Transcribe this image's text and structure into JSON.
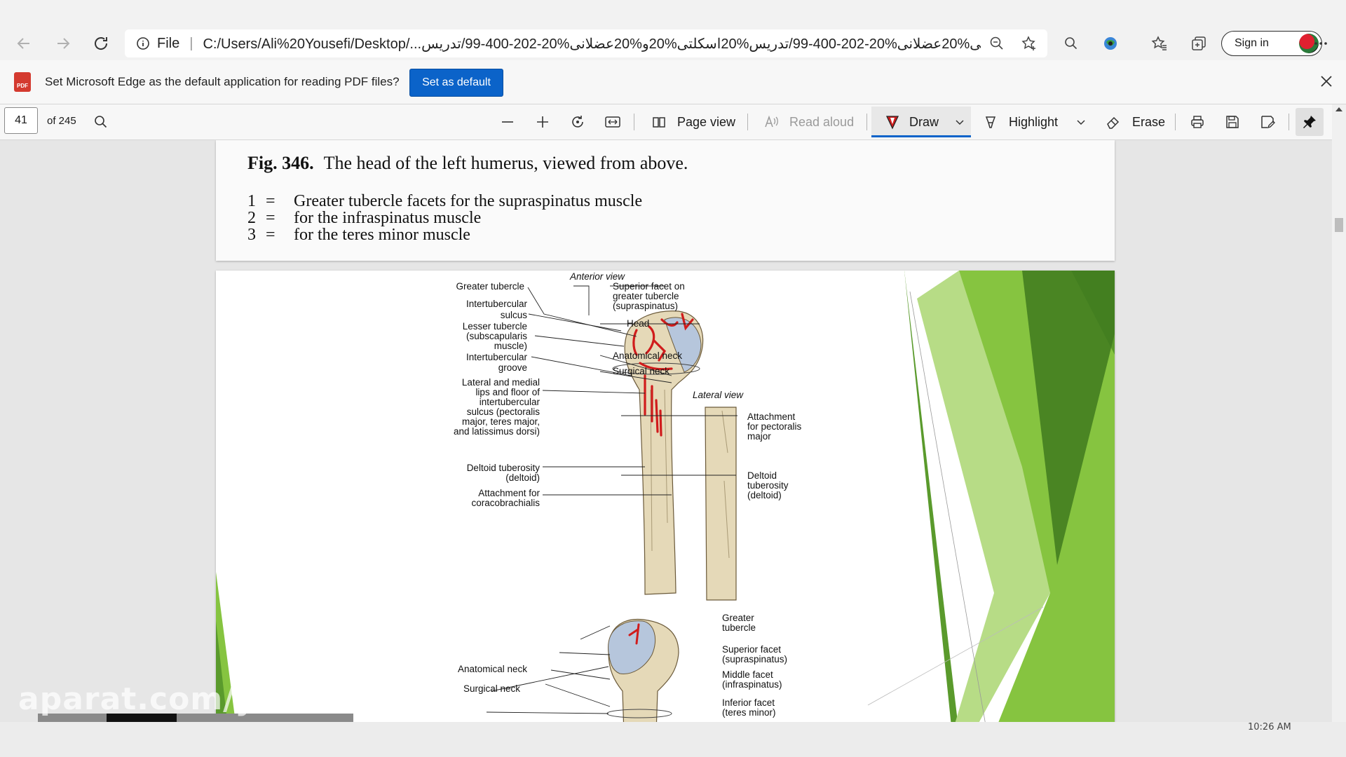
{
  "browser": {
    "address": {
      "scheme_label": "File",
      "url": "C:/Users/Ali%20Yousefi/Desktop/...تدریس%20اسکلتی%20عضلانی%20-202-400-99/تدریس%20اسکلتی%20و%20عضلانی%20-202-400-99/تدریس"
    },
    "sign_in_label": "Sign in",
    "icons": {
      "back": "back-arrow-icon",
      "forward": "forward-arrow-icon",
      "refresh": "refresh-icon",
      "info": "info-icon",
      "zoom": "zoom-out-icon",
      "favorite": "add-favorite-icon",
      "search": "search-icon",
      "extension": "extension-icon",
      "favorites": "favorites-icon",
      "collections": "collections-icon",
      "more": "more-icon"
    }
  },
  "infobar": {
    "message": "Set Microsoft Edge as the default application for reading PDF files?",
    "button_label": "Set as default",
    "badge_text": "PDF"
  },
  "pdf_toolbar": {
    "page_current": "41",
    "page_total": "of 245",
    "page_view_label": "Page view",
    "read_aloud_label": "Read aloud",
    "draw_label": "Draw",
    "highlight_label": "Highlight",
    "erase_label": "Erase",
    "accent_color": "#0b63c9",
    "draw_color": "#d01c1c"
  },
  "document": {
    "page1": {
      "fig_number": "Fig. 346.",
      "fig_title": "The head of the left humerus, viewed from above.",
      "legend": [
        {
          "num": "1",
          "eq": "=",
          "text": "Greater tubercle facets for the supraspinatus muscle"
        },
        {
          "num": "2",
          "eq": "=",
          "text": "for the infraspinatus muscle"
        },
        {
          "num": "3",
          "eq": "=",
          "text": "for the teres minor muscle"
        }
      ]
    },
    "page2": {
      "anterior_view": "Anterior view",
      "lateral_view": "Lateral view",
      "labels_left": {
        "greater_tubercle": "Greater tubercle",
        "intertubercular_sulcus": [
          "Intertubercular",
          "sulcus"
        ],
        "lesser_tubercle": [
          "Lesser tubercle",
          "(subscapularis",
          "muscle)"
        ],
        "intertubercular_groove": [
          "Intertubercular",
          "groove"
        ],
        "lips": [
          "Lateral and medial",
          "lips and floor of",
          "intertubercular",
          "sulcus (pectoralis",
          "major, teres major,",
          "and latissimus dorsi)"
        ],
        "deltoid_tuberosity": [
          "Deltoid tuberosity",
          "(deltoid)"
        ],
        "coracobrachialis": [
          "Attachment for",
          "coracobrachialis"
        ],
        "anatomical_neck": "Anatomical neck",
        "surgical_neck": "Surgical neck"
      },
      "labels_right": {
        "superior_facet": [
          "Superior facet on",
          "greater tubercle",
          "(supraspinatus)"
        ],
        "head": "Head",
        "anatomical_neck": "Anatomical neck",
        "surgical_neck": "Surgical neck",
        "pectoralis": [
          "Attachment",
          "for pectoralis",
          "major"
        ],
        "deltoid": [
          "Deltoid",
          "tuberosity",
          "(deltoid)"
        ],
        "greater_tubercle": [
          "Greater",
          "tubercle"
        ],
        "superior_facet_b": [
          "Superior facet",
          "(supraspinatus)"
        ],
        "middle_facet": [
          "Middle facet",
          "(infraspinatus)"
        ],
        "inferior_facet": [
          "Inferior facet",
          "(teres minor)"
        ]
      },
      "accent_greens": [
        "#5a9a2c",
        "#86c440",
        "#3f7a1f"
      ]
    }
  },
  "overlay": {
    "watermark": "aparat.com/y",
    "clock": "10:26 AM"
  }
}
